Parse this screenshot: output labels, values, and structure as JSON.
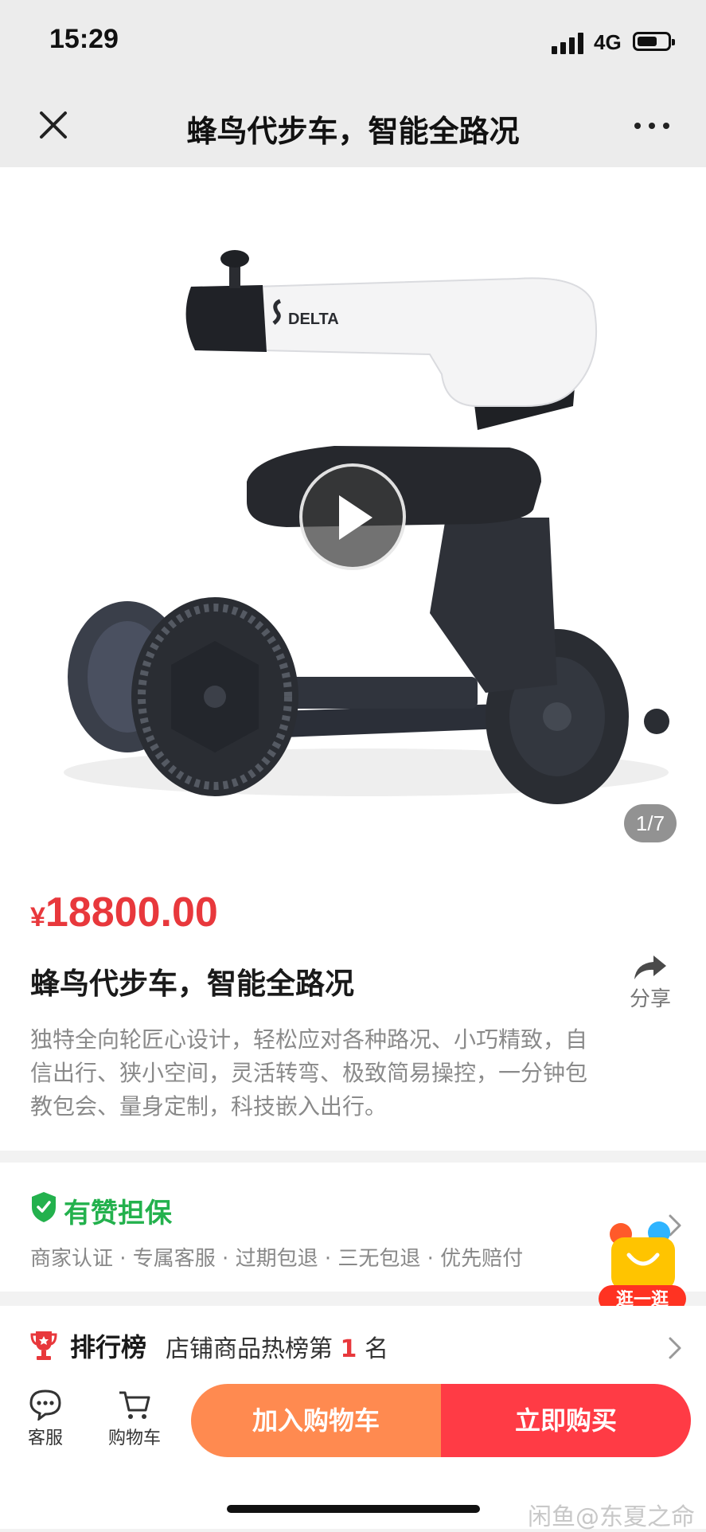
{
  "status_bar": {
    "time": "15:29",
    "network": "4G"
  },
  "nav": {
    "title": "蜂鸟代步车，智能全路况",
    "close_icon": "close-icon",
    "more_icon": "more-dots-icon"
  },
  "gallery": {
    "pager": "1/7",
    "brand_logo_text": "DELTA",
    "media": "play-icon"
  },
  "product": {
    "currency": "¥",
    "price": "18800.00",
    "title": "蜂鸟代步车，智能全路况",
    "share_label": "分享",
    "description": "独特全向轮匠心设计，轻松应对各种路况、小巧精致，自信出行、狭小空间，灵活转弯、极致简易操控，一分钟包教包会、量身定制，科技嵌入出行。"
  },
  "guarantee": {
    "title": "有赞担保",
    "items": "商家认证 · 专属客服 · 过期包退 · 三无包退 · 优先赔付"
  },
  "float_badge": {
    "label": "逛一逛"
  },
  "ranking": {
    "label": "排行榜",
    "text_prefix": "店铺商品热榜第",
    "rank": "1",
    "text_suffix": "名"
  },
  "bottom_bar": {
    "service_label": "客服",
    "cart_label": "购物车",
    "add_to_cart": "加入购物车",
    "buy_now": "立即购买"
  },
  "watermark": "闲鱼@东夏之命",
  "colors": {
    "price_red": "#e8383c",
    "guarantee_green": "#23b14d",
    "cart_orange": "#ff8a50",
    "buy_red": "#ff3b45"
  }
}
